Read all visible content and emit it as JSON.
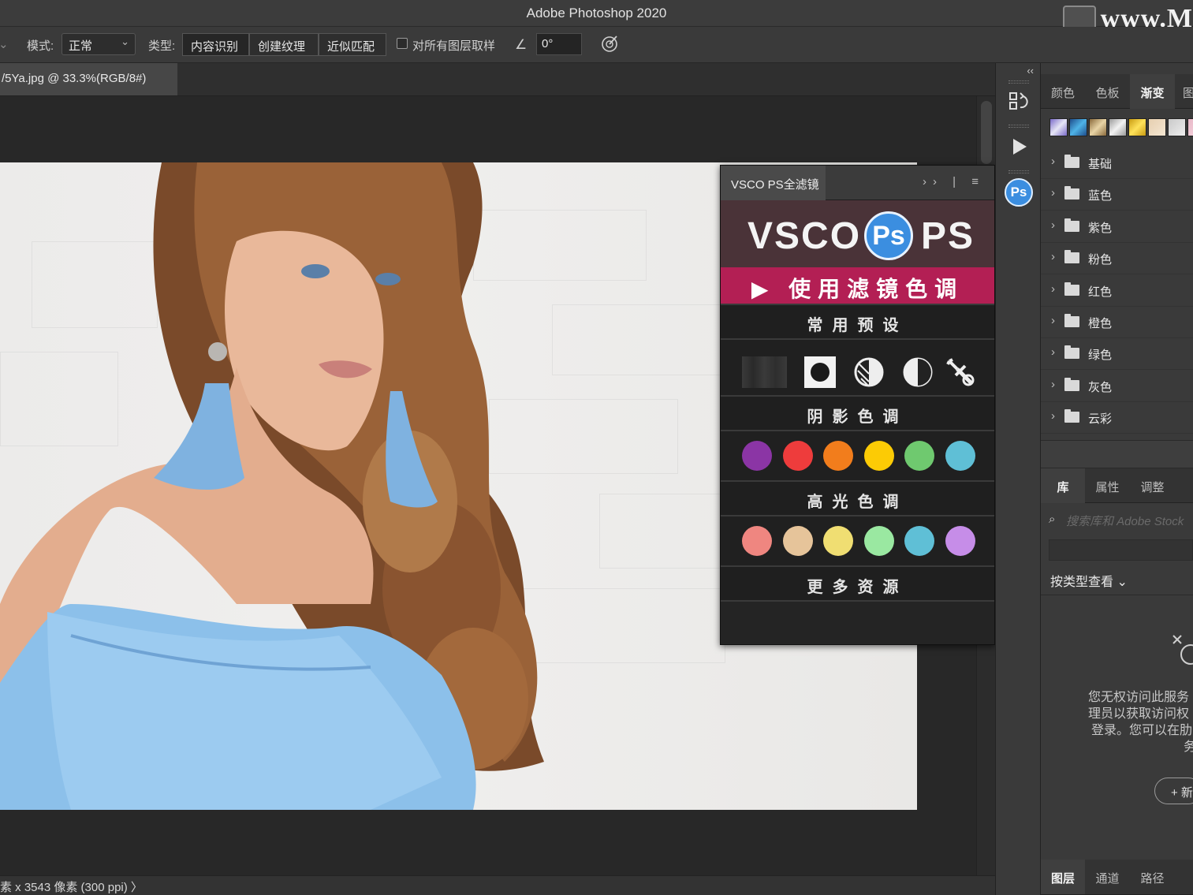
{
  "titlebar": {
    "title": "Adobe Photoshop 2020",
    "watermark": "www.M"
  },
  "options": {
    "mode_label": "模式:",
    "mode_value": "正常",
    "type_label": "类型:",
    "type_buttons": [
      "内容识别",
      "创建纹理",
      "近似匹配"
    ],
    "sample_all_label": "对所有图层取样",
    "angle_value": "0°"
  },
  "document": {
    "tab_title": "/5Ya.jpg @ 33.3%(RGB/8#)"
  },
  "status": {
    "text": "素 x 3543 像素 (300 ppi)",
    "arrow": "〉"
  },
  "plugin": {
    "tab_title": "VSCO PS全滤镜",
    "controls": "›› | ≡",
    "logo_left": "VSCO",
    "logo_mid": "Ps",
    "logo_right": "PS",
    "apply_label": "▶ 使用滤镜色调",
    "sections": {
      "presets": "常用预设",
      "shadow": "阴影色调",
      "highlight": "高光色调",
      "more": "更多资源"
    },
    "preset_tools": [
      "gradient-strip-icon",
      "vignette-icon",
      "half-contrast-icon",
      "half-tone-icon",
      "wrench-icon"
    ],
    "shadow_colors": [
      "#8b35a5",
      "#ee3c3c",
      "#f27d1c",
      "#fccb05",
      "#6fc96f",
      "#5fbfd6"
    ],
    "highlight_colors": [
      "#ef8680",
      "#e6c49a",
      "#f0de72",
      "#9ae8a1",
      "#5fbfd6",
      "#c68de8"
    ]
  },
  "iconcol": {
    "collapse": "‹‹",
    "ps_badge": "Ps"
  },
  "rpanel": {
    "top_tabs": [
      "颜色",
      "色板",
      "渐变",
      "图"
    ],
    "top_active": 2,
    "swatches": [
      "linear-gradient(135deg,#7a6ac9,#e6e6f5,#7a6ac9)",
      "linear-gradient(135deg,#1e4d8c,#4fb3e6,#1e4d8c)",
      "linear-gradient(135deg,#8a6a3c,#e8d4a6,#8a6a3c)",
      "linear-gradient(135deg,#9a9a9a,#f2f2f2,#9a9a9a)",
      "linear-gradient(135deg,#c89b12,#ffe25a,#c89b12)",
      "linear-gradient(135deg,#e6cfb0,#f4e6d2)",
      "linear-gradient(135deg,#c9c9c9,#eeeeee)",
      "linear-gradient(135deg,#e8b9c8,#f6d6e0)"
    ],
    "folders": [
      "基础",
      "蓝色",
      "紫色",
      "粉色",
      "红色",
      "橙色",
      "绿色",
      "灰色",
      "云彩"
    ],
    "lib_tabs": [
      "库",
      "属性",
      "调整"
    ],
    "lib_active": 0,
    "search_placeholder": "搜索库和 Adobe Stock",
    "view_by": "按类型查看",
    "message_lines": [
      "您无权访问此服务",
      "理员以获取访问权",
      "登录。您可以在肋",
      "务"
    ],
    "new_button": "+ 新",
    "bottom_tabs": [
      "图层",
      "通道",
      "路径"
    ],
    "bottom_active": 0
  }
}
